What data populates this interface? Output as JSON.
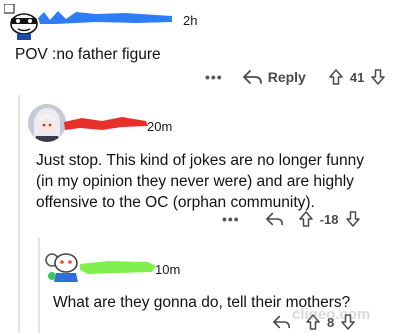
{
  "colors": {
    "accent_red": "#e8302a",
    "accent_blue": "#2f7df6",
    "accent_green": "#80f050",
    "text": "#1a1a1b",
    "icon": "#4a4a4a"
  },
  "comments": [
    {
      "time": "2h",
      "body": "POV :no father figure",
      "reply_label": "Reply",
      "score": "41",
      "username_redaction_color": "#2f7df6"
    },
    {
      "time": "20m",
      "body_lines": [
        "Just stop. This kind of jokes are no longer funny",
        "(in my opinion they never were) and are highly",
        "offensive to the OC (orphan community)."
      ],
      "score": "-18",
      "username_redaction_color": "#e8302a"
    },
    {
      "time": "10m",
      "body": "What are they gonna do, tell their mothers?",
      "score": "8",
      "username_redaction_color": "#80f050"
    }
  ],
  "watermark": "cliqeo.com"
}
